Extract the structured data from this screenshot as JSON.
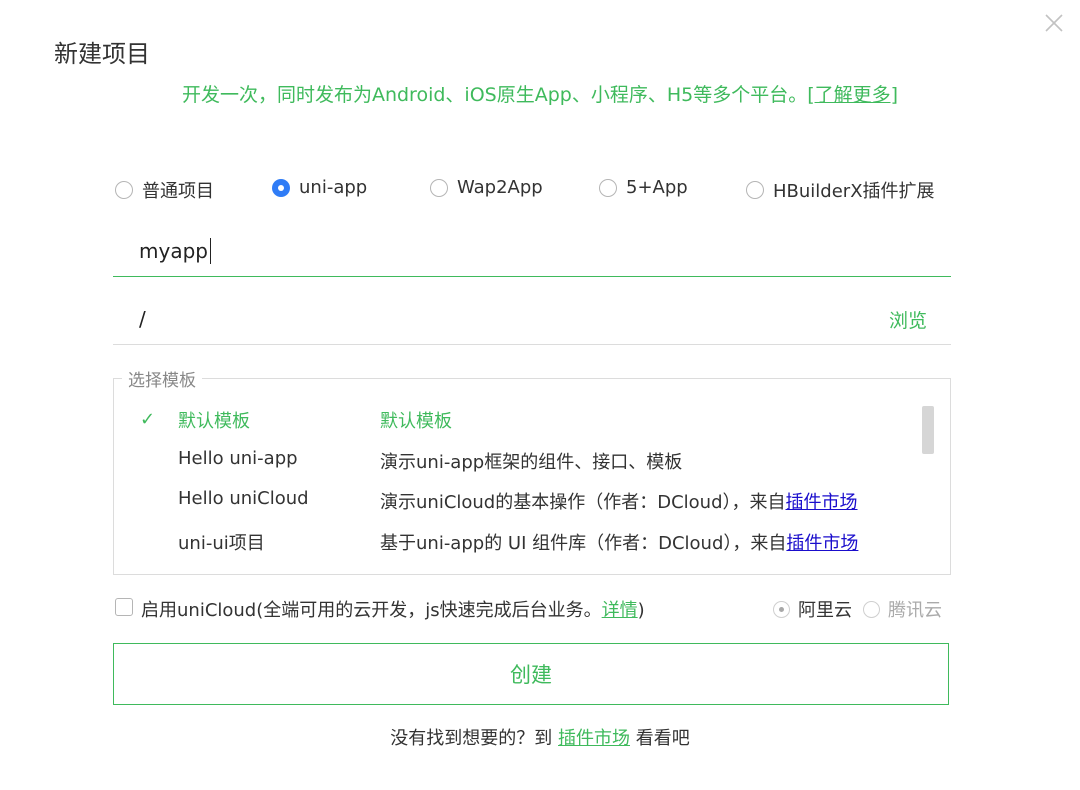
{
  "dialog": {
    "title": "新建项目",
    "subtitle": "开发一次，同时发布为Android、iOS原生App、小程序、H5等多个平台。",
    "learn_more": "[了解更多]"
  },
  "project_types": [
    {
      "label": "普通项目",
      "selected": false
    },
    {
      "label": "uni-app",
      "selected": true
    },
    {
      "label": "Wap2App",
      "selected": false
    },
    {
      "label": "5+App",
      "selected": false
    },
    {
      "label": "HBuilderX插件扩展",
      "selected": false
    }
  ],
  "project_name": {
    "value": "myapp"
  },
  "project_path": {
    "value": "/",
    "browse_label": "浏览"
  },
  "templates": {
    "legend": "选择模板",
    "items": [
      {
        "name": "默认模板",
        "desc": "默认模板",
        "desc_link": "",
        "selected": true
      },
      {
        "name": "Hello uni-app",
        "desc": "演示uni-app框架的组件、接口、模板",
        "desc_link": "",
        "selected": false
      },
      {
        "name": "Hello uniCloud",
        "desc": "演示uniCloud的基本操作（作者：DCloud），来自",
        "desc_link": "插件市场",
        "selected": false
      },
      {
        "name": "uni-ui项目",
        "desc": "基于uni-app的 UI 组件库（作者：DCloud），来自",
        "desc_link": "插件市场",
        "selected": false
      }
    ]
  },
  "unicloud": {
    "checkbox_label": "启用uniCloud(全端可用的云开发，js快速完成后台业务。",
    "detail_link": "详情",
    "close_paren": ")",
    "providers": [
      {
        "label": "阿里云",
        "selected": true
      },
      {
        "label": "腾讯云",
        "selected": false
      }
    ]
  },
  "create_button": "创建",
  "footer": {
    "prefix": "没有找到想要的？到 ",
    "link": "插件市场",
    "suffix": " 看看吧"
  },
  "colors": {
    "accent": "#3fba5c",
    "radio_selected": "#2f7cf6",
    "link": "#1a0dcc"
  }
}
